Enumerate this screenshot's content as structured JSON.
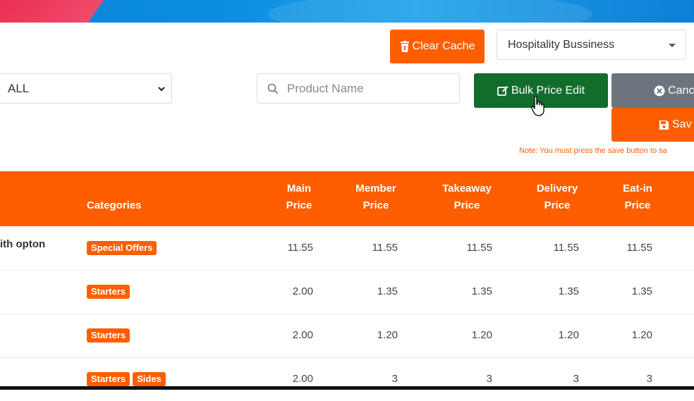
{
  "toolbar": {
    "clear_cache_label": "Clear Cache",
    "business_select_value": "Hospitality Bussiness",
    "category_select_value": "ALL",
    "search_placeholder": "Product Name",
    "bulk_price_edit_label": "Bulk Price Edit",
    "cancel_label": "Canc",
    "save_label": "Sav",
    "note": "Note: You must press the save button to sa"
  },
  "table": {
    "headers": {
      "categories": "Categories",
      "main_price": [
        "Main",
        "Price"
      ],
      "member_price": [
        "Member",
        "Price"
      ],
      "takeaway_price": [
        "Takeaway",
        "Price"
      ],
      "delivery_price": [
        "Delivery",
        "Price"
      ],
      "eat_in_price": [
        "Eat-in",
        "Price"
      ]
    },
    "rows": [
      {
        "name": "ith opton",
        "categories": [
          "Special Offers"
        ],
        "main": "11.55",
        "member": "11.55",
        "takeaway": "11.55",
        "delivery": "11.55",
        "eatin": "11.55"
      },
      {
        "name": "",
        "categories": [
          "Starters"
        ],
        "main": "2.00",
        "member": "1.35",
        "takeaway": "1.35",
        "delivery": "1.35",
        "eatin": "1.35"
      },
      {
        "name": "",
        "categories": [
          "Starters"
        ],
        "main": "2.00",
        "member": "1.20",
        "takeaway": "1.20",
        "delivery": "1.20",
        "eatin": "1.20"
      },
      {
        "name": "",
        "categories": [
          "Starters",
          "Sides"
        ],
        "main": "2.00",
        "member": "3",
        "takeaway": "3",
        "delivery": "3",
        "eatin": "3"
      }
    ]
  },
  "colors": {
    "accent_orange": "#ff5e00",
    "green": "#126c2c",
    "gray": "#6c757d",
    "topbar_blue": "#0b8de0"
  },
  "icons": [
    "trash-icon",
    "edit-icon",
    "close-circle-icon",
    "save-icon",
    "search-icon",
    "caret-down-icon",
    "hand-cursor-icon"
  ]
}
